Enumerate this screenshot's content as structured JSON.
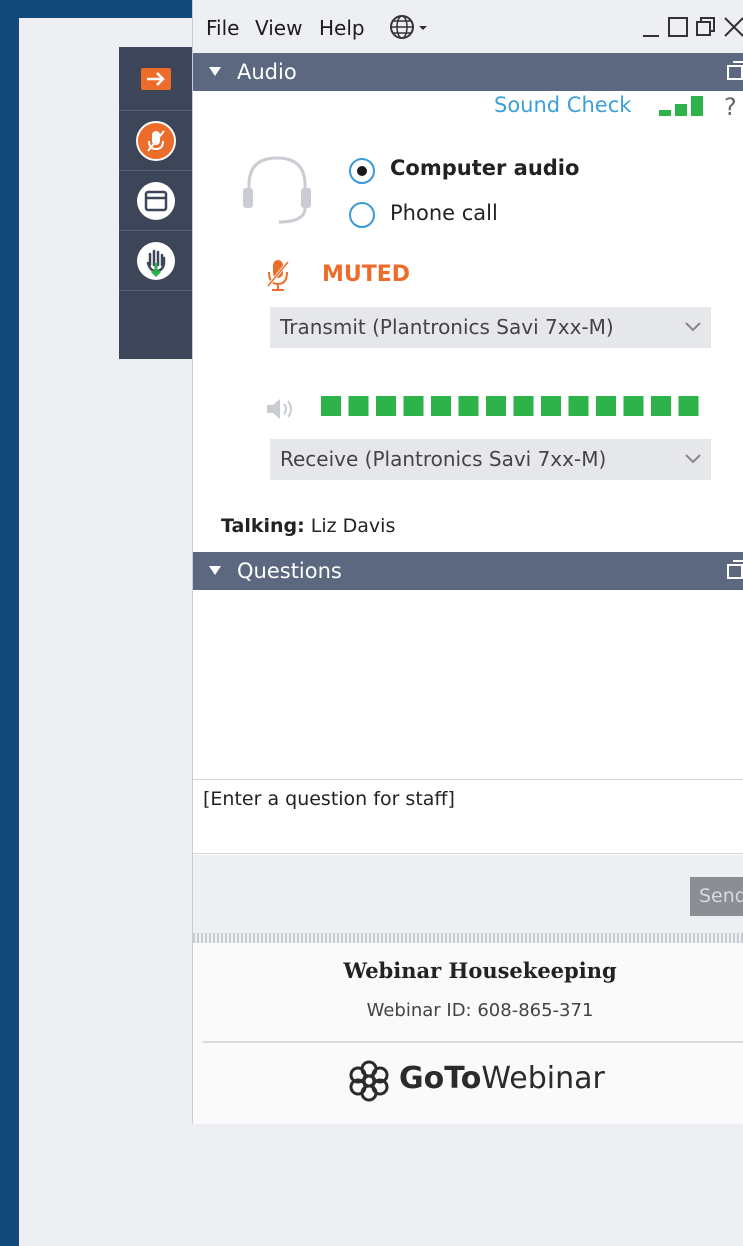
{
  "menu": {
    "file": "File",
    "view": "View",
    "help": "Help"
  },
  "audio": {
    "header": "Audio",
    "sound_check": "Sound Check",
    "help": "?",
    "options": [
      "Computer audio",
      "Phone call"
    ],
    "selected_option": "Computer audio",
    "status": "MUTED",
    "transmit_device": "Transmit (Plantronics Savi 7xx-M)",
    "receive_device": "Receive (Plantronics Savi 7xx-M)",
    "level_segments": 14,
    "talking_label": "Talking:",
    "talking_name": "Liz Davis"
  },
  "questions": {
    "header": "Questions",
    "input_placeholder": "[Enter a question for staff]",
    "send_label": "Send"
  },
  "footer": {
    "title": "Webinar Housekeeping",
    "webinar_id": "Webinar ID: 608-865-371",
    "brand_bold": "GoTo",
    "brand_light": "Webinar"
  },
  "colors": {
    "accent_orange": "#ec6d2b",
    "link_blue": "#3da0d9",
    "level_green": "#2db34a",
    "header_bar": "#5c6880"
  }
}
